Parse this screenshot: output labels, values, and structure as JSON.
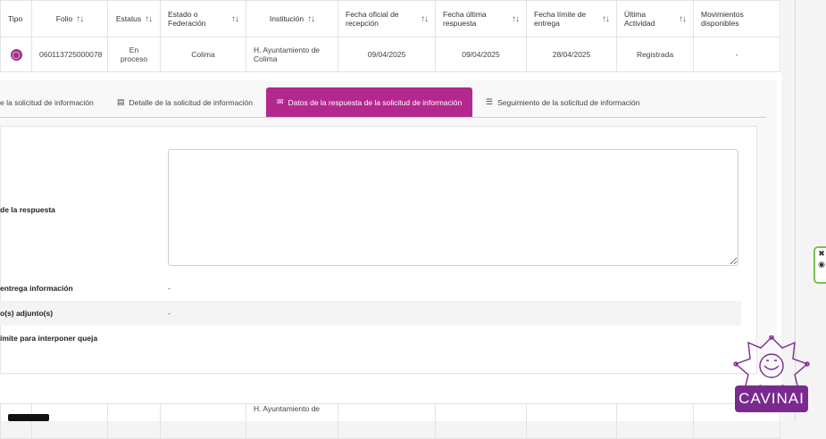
{
  "table": {
    "headers": [
      "Tipo",
      "Folio",
      "Estatus",
      "Estado o Federación",
      "Institución",
      "Fecha oficial de recepción",
      "Fecha última respuesta",
      "Fecha límite de entrega",
      "Última Actividad",
      "Movimientos disponibles"
    ],
    "sort_glyph": "↑↓",
    "row": {
      "folio": "060113725000078",
      "estatus": "En proceso",
      "estado": "Colima",
      "institucion": "H. Ayuntamiento de Colima",
      "fecha_recepcion": "09/04/2025",
      "fecha_respuesta": "09/04/2025",
      "fecha_limite": "28/04/2025",
      "actividad": "Registrada",
      "movimientos": "-"
    },
    "row2": {
      "institucion": "H. Ayuntamiento de"
    }
  },
  "tabs": [
    {
      "label": "e la solicitud de información"
    },
    {
      "label": "Detalle de la solicitud de información"
    },
    {
      "label": "Datos de la respuesta de la solicitud de información"
    },
    {
      "label": "Seguimiento de la solicitud de información"
    }
  ],
  "details": {
    "respuesta_label": "de la respuesta",
    "entrega_label": "entrega información",
    "entrega_value": "-",
    "adjunto_label": "o(s) adjunto(s)",
    "adjunto_value": "-",
    "queja_label": "ímite para interponer queja"
  },
  "logo": {
    "text": "CAVINAI"
  },
  "colors": {
    "accent": "#b3288f",
    "logo_bg": "#7a2a8f",
    "side_border": "#7bbf4e"
  }
}
